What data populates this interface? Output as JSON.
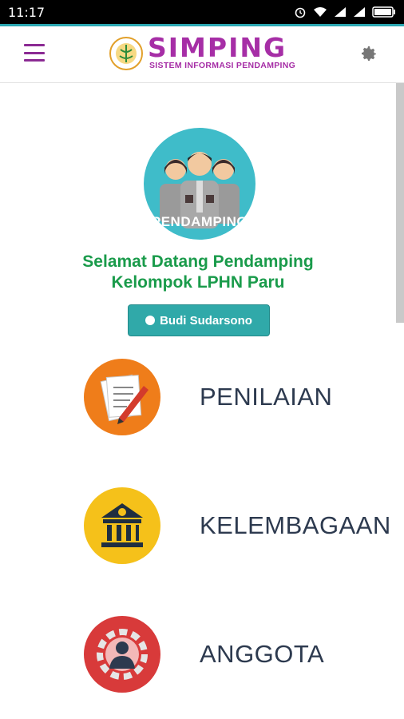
{
  "status_bar": {
    "time": "11:17"
  },
  "header": {
    "logo_title": "SIMPING",
    "logo_subtitle": "SISTEM INFORMASI PENDAMPING"
  },
  "profile": {
    "avatar_label": "PENDAMPING",
    "welcome_line1": "Selamat Datang Pendamping",
    "welcome_line2": "Kelompok LPHN Paru",
    "user_name": "Budi Sudarsono"
  },
  "menu": {
    "items": [
      {
        "label": "PENILAIAN",
        "icon": "document-pen-icon",
        "color": "#ef7d1a"
      },
      {
        "label": "KELEMBAGAAN",
        "icon": "bank-building-icon",
        "color": "#f5c11a"
      },
      {
        "label": "ANGGOTA",
        "icon": "member-gear-icon",
        "color": "#d83a3a"
      }
    ]
  },
  "colors": {
    "brand_purple": "#a62ea6",
    "accent_teal": "#30a9a9",
    "welcome_green": "#1a9b4b"
  }
}
